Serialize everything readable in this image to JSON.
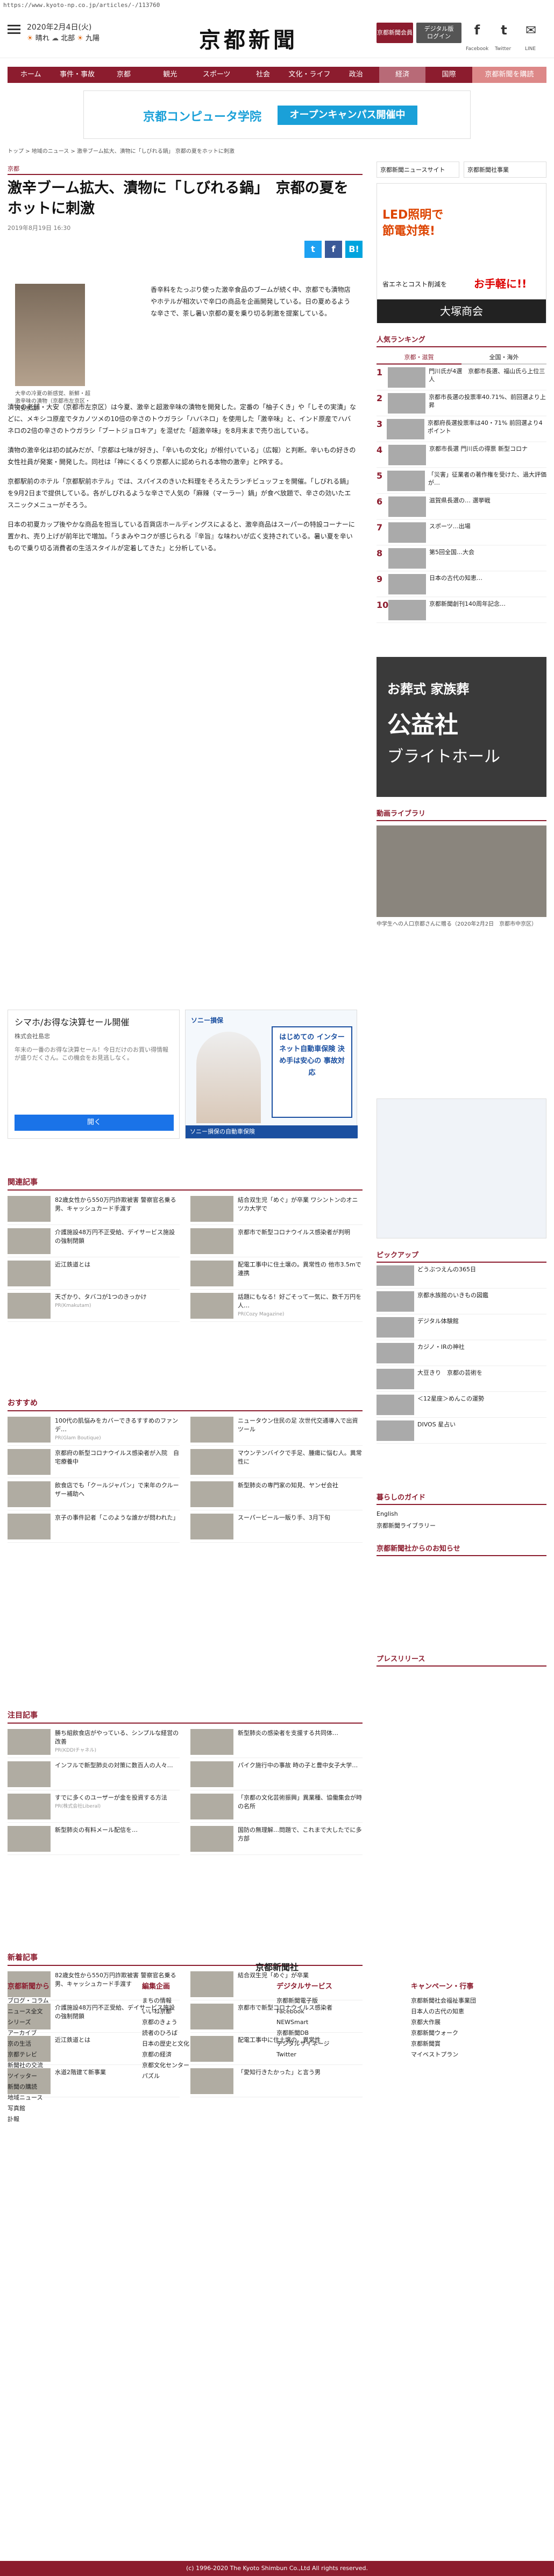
{
  "url": "https://www.kyoto-np.co.jp/articles/-/113760",
  "header": {
    "date": "2020年2月4日(火)",
    "weather": [
      "晴れ",
      "北部",
      "九陽"
    ],
    "logo": "京都新聞",
    "member_btn": "京都新聞会員",
    "digital_btn": "デジタル版\nログイン",
    "social_labels": [
      "Facebook",
      "Twitter",
      "LINE"
    ]
  },
  "nav": [
    "ホーム",
    "事件・事故",
    "京都",
    "観光",
    "スポーツ",
    "社会",
    "文化・ライフ",
    "政治",
    "経済",
    "国際",
    "京都新聞を購読"
  ],
  "banner_top": {
    "school": "京都コンピュータ学院",
    "open": "オープンキャンパス開催中"
  },
  "breadcrumb": "トップ > 地域のニュース > 激辛ブーム拡大、漬物に「しびれる鍋」 京都の夏をホットに刺激",
  "article": {
    "category": "京都",
    "title": "激辛ブーム拡大、漬物に「しびれる鍋」　京都の夏をホットに刺激",
    "date": "2019年8月19日 16:30",
    "caption": "大辛の冷夏の新感覚、新鮮・超激辛味の漬物（京都市左京区・大安京店）",
    "lead": "香辛料をたっぷり使った激辛食品のブームが続く中、京都でも漬物店やホテルが相次いで辛口の商品を企画開発している。日の夏めるような辛さで、茶し暑い京都の夏を乗り切る刺激を提案している。",
    "paragraphs": [
      "漬物の老舗・大安（京都市左京区）は今夏、激辛と超激辛味の漬物を開発した。定番の「柚子くき」や「しその実漬」などに、メキシコ原産でタカノツメの10倍の辛さのトウガラシ「ハバネロ」を使用した「激辛味」と、インド原産でハバネロの2倍の辛さのトウガラシ「ブートジョロキア」を混ぜた「超激辛味」を8月末まで売り出している。",
      "漬物の激辛化は初の試みだが、「京都は七味が好き」、「辛いもの文化」が根付いている」（広報）と判断。辛いもの好きの女性社員が発案・開発した。同社は「神にくるくり京都人に認められる本物の激辛」とPRする。",
      "京都駅前のホテル「京都駅前ホテル」では、スパイスのきいた料理をそろえたランチビュッフェを開催。「しびれる鍋」を9月2日まで提供している。各がしびれるような辛さで人気の「麻辣（マーラー）鍋」が食べ放題で、辛さの効いたエスニックメニューがそろう。",
      "日本の初夏カップ後やかな商品を担当している百貨店ホールディングスによると、激辛商品はスーパーの特設コーナーに置かれ、売り上げが前年比で増加。「うまみやコクが感じられる『辛旨』な味わいが広く支持されている。暑い夏を辛いもので乗り切る消費者の生活スタイルが定着してきた」と分析している。"
    ]
  },
  "ads": {
    "simanui": {
      "title": "シマホ/お得な決算セール開催",
      "company": "株式会社島忠",
      "text": "年末の一番のお得な決算セール！今日だけのお買い得情報が盛りだくさん。この機会をお見逃しなく。",
      "btn": "開く"
    },
    "sony": {
      "brand": "ソニー損保",
      "copy": "はじめての インターネット自動車保険 決め手は安心の 事故対応",
      "bar": "ソニー損保の自動車保険"
    }
  },
  "sections": {
    "related": "関連記事",
    "recommend": "おすすめ",
    "attention": "注目記事",
    "new": "新着記事"
  },
  "related_items": [
    [
      "82歳女性から550万円詐欺被害 警察官名乗る男、キャッシュカード手渡す",
      ""
    ],
    [
      "結合双生児「めぐ」が卒業 ワシントンのオニツカ大学で",
      ""
    ],
    [
      "介護施設48万円不正受給、デイサービス施設の強制閉鎖",
      ""
    ],
    [
      "京都市で新型コロナウイルス感染者が判明",
      ""
    ],
    [
      "近江鉄道とは",
      ""
    ],
    [
      "配電工事中に住土壌の。異常性の 他市3.5mで連携",
      ""
    ],
    [
      "天ざかり、タバコが1つのきっかけ",
      "PR(Kmakutam)"
    ],
    [
      "話題にもなる！好ごそって一気に、数千万円を人…",
      "PR(Cozy Magazine)"
    ]
  ],
  "recommend_items": [
    [
      "100代の肌悩みをカバーできるすすめのファンデ…",
      "PR(Glam Boutique)"
    ],
    [
      "ニュータウン住民の足 次世代交通導入で出資ツール",
      ""
    ],
    [
      "京都府の新型コロナウイルス感染者が入院　自宅療養中",
      ""
    ],
    [
      "マウンテンバイクで手足、腫瘍に悩む人。異常性に",
      ""
    ],
    [
      "飲食店でも「クールジャパン」で来年のクルーザー補助へ",
      ""
    ],
    [
      "新型肺炎の専門家の知見、ヤンゼ会社"
    ],
    [
      "京子の事件記者「このような誰かが問われた」",
      ""
    ],
    [
      "スーパービール一販り手、3月下旬",
      ""
    ]
  ],
  "attention_items": [
    [
      "勝ち組飲食店がやっている、シンプルな経営の改善",
      "PR(KDDIチャネル)"
    ],
    [
      "新型肺炎の感染者を支援する共同体…",
      ""
    ],
    [
      "インフルで新型肺炎の対策に数百人の人々…",
      ""
    ],
    [
      "パイク施行中の事故 時の子と豊中女子大学…",
      ""
    ],
    [
      "すでに多くのユーザーが金を投資する方法",
      "PR(株式会社Liberal)"
    ],
    [
      "「京都の文化芸術振興」異業種、協働集会が時の名所",
      ""
    ],
    [
      "新型肺炎の有料メール配信を…",
      ""
    ],
    [
      "国防の無理解…問題で、これまで大したでに多方部",
      ""
    ]
  ],
  "new_items": [
    [
      "82歳女性から550万円詐欺被害 警察官名乗る男、キャッシュカード手渡す",
      ""
    ],
    [
      "結合双生児「めぐ」が卒業",
      ""
    ],
    [
      "介護施設48万円不正受給、デイサービス施設の強制閉鎖",
      ""
    ],
    [
      "京都市で新型コロナウイルス感染者",
      ""
    ],
    [
      "近江鉄道とは",
      ""
    ],
    [
      "配電工事中に住土壌の。異常性",
      ""
    ],
    [
      "水道2階建て新事業",
      ""
    ],
    [
      "「愛知行きたかった」と言う男",
      ""
    ]
  ],
  "sidebar": {
    "links": [
      "京都新聞ニュースサイト",
      "京都新聞社事業"
    ],
    "ad_led": {
      "line1": "LED照明で",
      "line2": "節電対策!",
      "sub": "省エネとコスト削減を",
      "price": "お手軽に!!",
      "company": "大塚商会"
    },
    "ranking_title": "人気ランキング",
    "ranking_tabs": [
      "京都・滋賀",
      "全国・海外"
    ],
    "ranking": [
      "門川氏が4選　京都市長選、福山氏ら上位三人",
      "京都市長選の投票率40.71%、前回選より上昇",
      "京都府長選投票率は40・71% 前回選より4ポイント",
      "京都市長選 門川氏の得票 新型コロナ",
      "「災害」征業者の著作権を受けた、過大評価が…",
      "滋賀県長選の… 選挙戦",
      "スポーツ…出場",
      "第5回全国…大会",
      "日本の古代の知恵…",
      "京都新聞創刊140周年記念…"
    ],
    "funeral_ad": {
      "l1": "お葬式 家族葬",
      "l2": "公益社",
      "l3": "ブライトホール"
    },
    "video_title": "動画ライブラリ",
    "video_caption": "中学生への人口京都さんに贈る（2020年2月2日　京都市中京区）",
    "pickup": "ピックアップ",
    "pickup_items": [
      "どうぶつえんの365日",
      "京都水族館のいきもの図鑑",
      "デジタル体験館",
      "カジノ・IRの神社",
      "大豆きり　京都の芸術を",
      "＜12星座＞めんこの運勢",
      "DIVOS 星占い"
    ],
    "guide": "暮らしのガイド",
    "guide_items": [
      "English",
      "京都新聞ライブラリー",
      "京都新聞社からのお知らせ"
    ],
    "press": "プレスリリース"
  },
  "footer": {
    "logo": "京都新聞社",
    "cols": [
      {
        "h": "京都新聞から",
        "items": [
          "ブログ・コラム",
          "ニュース全文",
          "シリーズ",
          "アーカイブ",
          "京の生活",
          "京都テレビ",
          "新聞社の交流",
          "ツイッター",
          "新聞の購読",
          "地域ニュース",
          "写真館",
          "訃報"
        ]
      },
      {
        "h": "編集企画",
        "items": [
          "まちの情報",
          "いいね京都",
          "京都のきょう",
          "読者のひろば",
          "日本の歴史と文化",
          "京都の経済",
          "京都文化センター",
          "パズル"
        ]
      },
      {
        "h": "デジタルサービス",
        "items": [
          "京都新聞電子版",
          "Facebook",
          "NEWSmart",
          "京都新聞DB",
          "デジタルサイネージ",
          "Twitter"
        ]
      },
      {
        "h": "キャンペーン・行事",
        "items": [
          "京都新聞社会福祉事業団",
          "日本人の古代の知恵",
          "京都大作展",
          "京都新聞ウォーク",
          "京都新聞賞",
          "マイベストプラン"
        ]
      }
    ],
    "copyright": "(c) 1996-2020 The Kyoto Shimbun Co.,Ltd All rights reserved."
  },
  "colors": {
    "brand": "#8c1c2e",
    "accent": "#1aa0d8"
  }
}
